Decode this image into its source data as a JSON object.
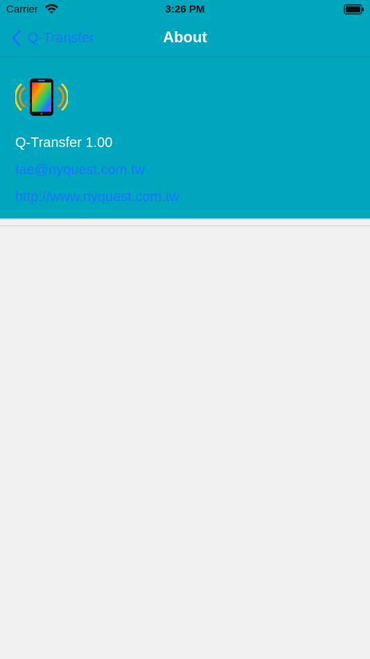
{
  "status_bar": {
    "carrier": "Carrier",
    "time": "3:26 PM",
    "wifi_icon": "wifi-icon",
    "battery_icon": "battery-icon"
  },
  "nav_bar": {
    "back_label": "Q-Transfer",
    "back_icon": "chevron-left-icon",
    "title": "About"
  },
  "about": {
    "app_icon": "phone-signal-icon",
    "version": "Q-Transfer 1.00",
    "email": "fae@nyquest.com.tw",
    "website": "http://www.nyquest.com.tw"
  },
  "colors": {
    "header_background": "#00a6bd",
    "link": "#1a73ff",
    "page_background": "#efefef"
  }
}
